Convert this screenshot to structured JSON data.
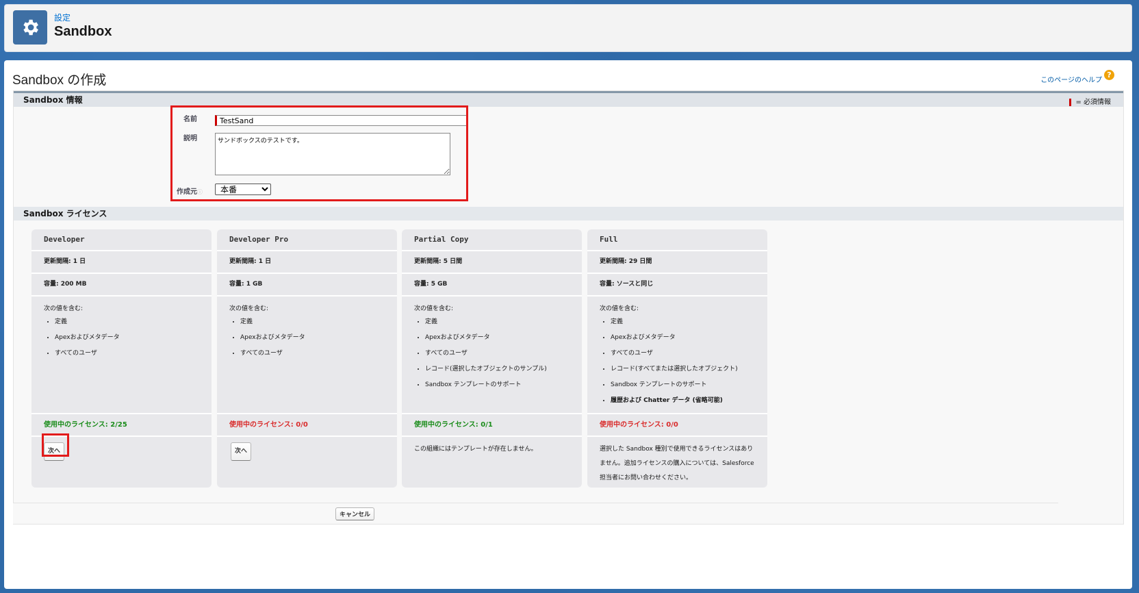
{
  "header": {
    "breadcrumb": "設定",
    "title": "Sandbox",
    "icon": "gear-icon"
  },
  "page": {
    "title": "Sandbox の作成",
    "help_link": "このページのヘルプ",
    "help_icon": "?"
  },
  "info_section": {
    "title": "Sandbox 情報",
    "required_legend": "= 必須情報",
    "name_label": "名前",
    "name_value": "TestSand",
    "description_label": "説明",
    "description_value": "サンドボックスのテストです。",
    "source_label": "作成元",
    "source_value": "本番",
    "source_info_icon": "info-icon"
  },
  "license_section": {
    "title": "Sandbox ライセンス"
  },
  "cards": [
    {
      "name": "Developer",
      "refresh": "更新間隔: 1 日",
      "storage": "容量: 200 MB",
      "includes_label": "次の値を含む:",
      "includes": [
        "定義",
        "Apexおよびメタデータ",
        "すべてのユーザ"
      ],
      "license": "使用中のライセンス: 2/25",
      "license_color": "#1a8c1a",
      "button": "次へ"
    },
    {
      "name": "Developer Pro",
      "refresh": "更新間隔: 1 日",
      "storage": "容量: 1 GB",
      "includes_label": "次の値を含む:",
      "includes": [
        "定義",
        "Apexおよびメタデータ",
        "すべてのユーザ"
      ],
      "license": "使用中のライセンス: 0/0",
      "license_color": "#d92b2b",
      "button": "次へ"
    },
    {
      "name": "Partial Copy",
      "refresh": "更新間隔: 5 日間",
      "storage": "容量: 5 GB",
      "includes_label": "次の値を含む:",
      "includes": [
        "定義",
        "Apexおよびメタデータ",
        "すべてのユーザ",
        "レコード(選択したオブジェクトのサンプル)",
        "Sandbox テンプレートのサポート"
      ],
      "license": "使用中のライセンス: 0/1",
      "license_color": "#1a8c1a",
      "message": "この組織にはテンプレートが存在しません。"
    },
    {
      "name": "Full",
      "refresh": "更新間隔: 29 日間",
      "storage": "容量: ソースと同じ",
      "includes_label": "次の値を含む:",
      "includes": [
        "定義",
        "Apexおよびメタデータ",
        "すべてのユーザ",
        "レコード(すべてまたは選択したオブジェクト)",
        "Sandbox テンプレートのサポート",
        "履歴および Chatter データ (省略可能)"
      ],
      "license": "使用中のライセンス: 0/0",
      "license_color": "#d92b2b",
      "message": "選択した Sandbox 種別で使用できるライセンスはありません。追加ライセンスの購入については、Salesforce 担当者にお問い合わせください。"
    }
  ],
  "footer": {
    "cancel_button": "キャンセル"
  }
}
